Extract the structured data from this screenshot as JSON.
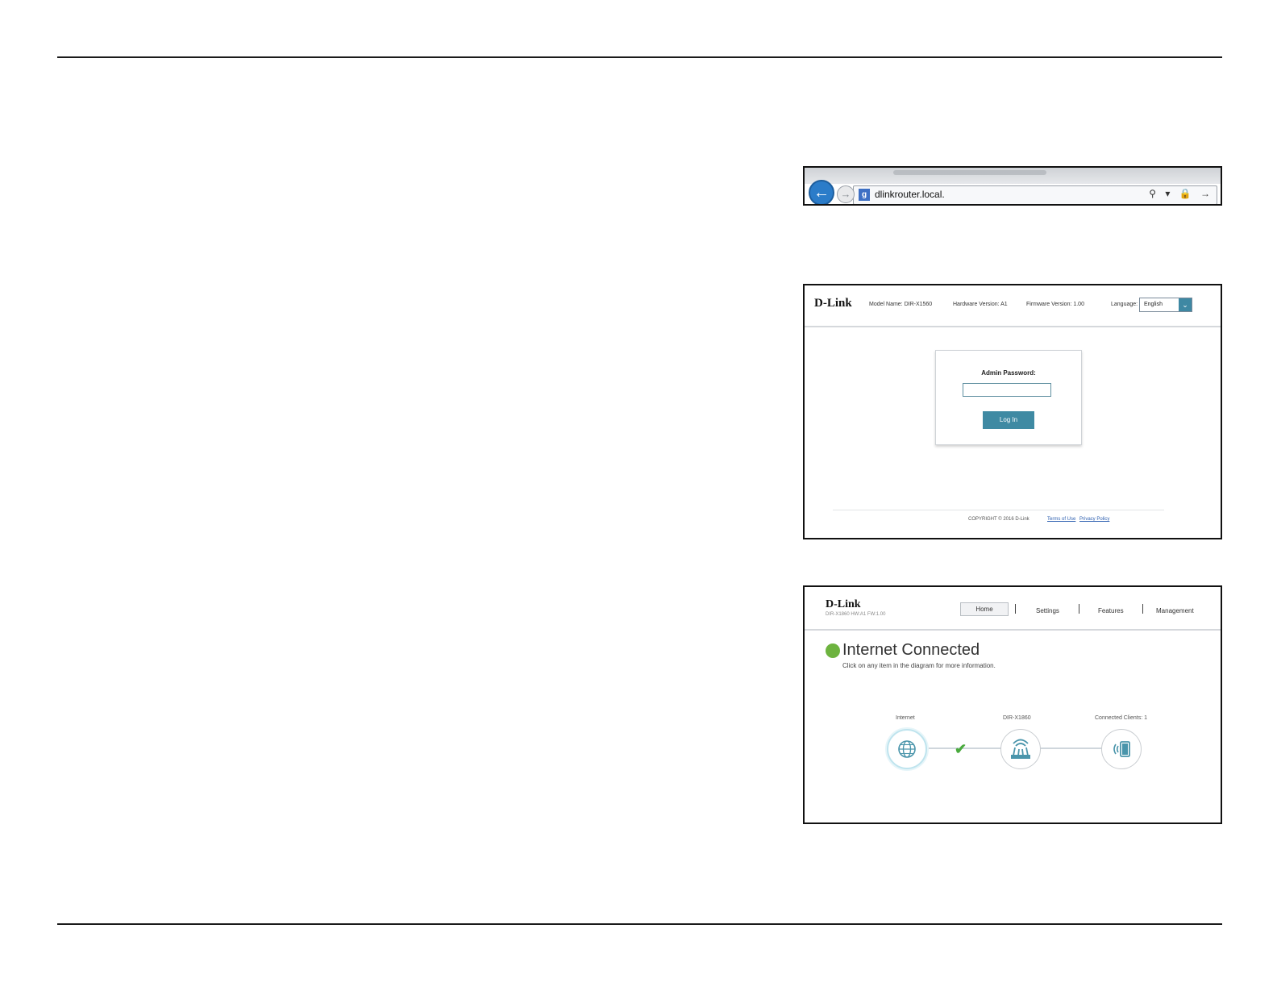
{
  "browser": {
    "url": "dlinkrouter.local.",
    "back_glyph": "←",
    "forward_glyph": "→",
    "search_badge": "g",
    "tools_glyphs": "⚲ ▾ 🔒 →"
  },
  "login_page": {
    "logo": "D-Link",
    "model_name": "Model Name: DIR-X1560",
    "hardware_version": "Hardware Version: A1",
    "firmware_version": "Firmware Version: 1.00",
    "language_label": "Language:",
    "language_value": "English",
    "password_label": "Admin Password:",
    "password_value": "",
    "login_button": "Log In",
    "copyright": "COPYRIGHT © 2016 D-Link",
    "terms_link": "Terms of Use",
    "privacy_link": "Privacy Policy"
  },
  "home_page": {
    "logo": "D-Link",
    "subtitle": "DIR-X1860 HW:A1 FW:1.00",
    "nav": [
      "Home",
      "Settings",
      "Features",
      "Management"
    ],
    "status_title": "Internet Connected",
    "status_desc": "Click on any item in the diagram for more information.",
    "status_color": "#6db33f",
    "diagram": {
      "internet_label": "Internet",
      "router_label": "DIR-X1860",
      "clients_label": "Connected Clients: 1"
    }
  }
}
